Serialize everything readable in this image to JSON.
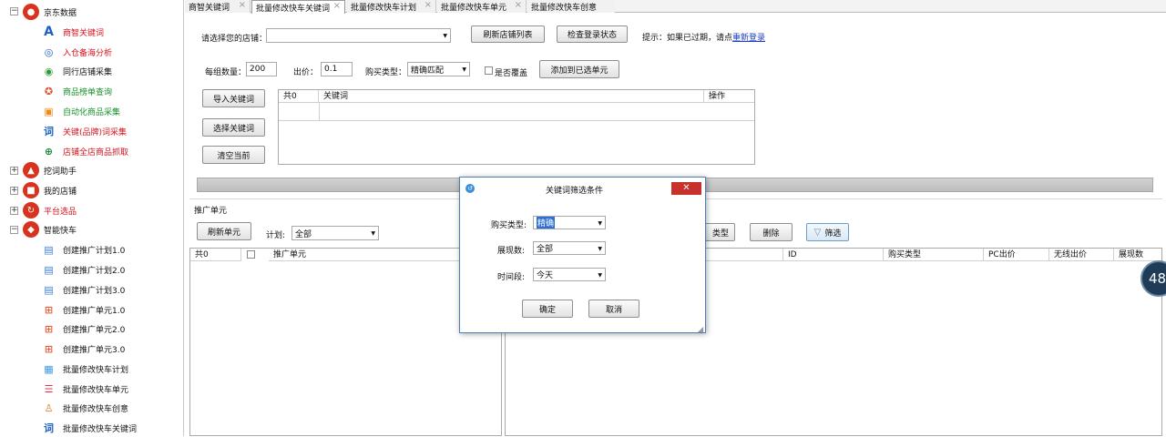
{
  "sidebar": {
    "root_label": "京东数据",
    "children": [
      {
        "label": "商智关键词",
        "color": "#d8101b",
        "icon": "font-a-icon"
      },
      {
        "label": "入仓备海分析",
        "color": "#d8101b",
        "icon": "target-icon"
      },
      {
        "label": "同行店铺采集",
        "color": "#111111",
        "icon": "eye-icon"
      },
      {
        "label": "商品榜单查询",
        "color": "#16932a",
        "icon": "medal-icon"
      },
      {
        "label": "自动化商品采集",
        "color": "#16932a",
        "icon": "bag-icon"
      },
      {
        "label": "关键(品牌)词采集",
        "color": "#d8101b",
        "icon": "keyword-search-icon"
      },
      {
        "label": "店铺全店商品抓取",
        "color": "#d8101b",
        "icon": "globe-search-icon"
      }
    ],
    "groups": [
      {
        "label": "挖词助手",
        "color": "#111111"
      },
      {
        "label": "我的店铺",
        "color": "#111111"
      },
      {
        "label": "平台选品",
        "color": "#d8101b"
      }
    ],
    "car_label": "智能快车",
    "car_children": [
      "创建推广计划1.0",
      "创建推广计划2.0",
      "创建推广计划3.0",
      "创建推广单元1.0",
      "创建推广单元2.0",
      "创建推广单元3.0",
      "批量修改快车计划",
      "批量修改快车单元",
      "批量修改快车创意",
      "批量修改快车关键词"
    ],
    "expander_minus": "⊟",
    "expander_plus": "⊞"
  },
  "tabs": [
    {
      "label": "商智关键词",
      "active": false
    },
    {
      "label": "批量修改快车关键词",
      "active": true
    },
    {
      "label": "批量修改快车计划",
      "active": false
    },
    {
      "label": "批量修改快车单元",
      "active": false
    },
    {
      "label": "批量修改快车创意",
      "active": false
    }
  ],
  "tab_close": "×",
  "form": {
    "shop_label": "请选择您的店铺：",
    "shop_value": "",
    "refresh_shop_btn": "刷新店铺列表",
    "check_login_btn": "检查登录状态",
    "hint": "提示：如果已过期，请点",
    "relogin_link": "重新登录",
    "group_count_label": "每组数量：",
    "group_count_value": "200",
    "bid_label": "出价：",
    "bid_value": "0.1",
    "buy_type_label": "购买类型：",
    "buy_type_value": "精确匹配",
    "overwrite_label": "是否覆盖",
    "add_to_unit_btn": "添加到已选单元",
    "import_kw_btn": "导入关键词",
    "select_kw_btn": "选择关键词",
    "clear_btn": "清空当前"
  },
  "kw_grid": {
    "headers": [
      "共0",
      "关键词",
      "操作"
    ]
  },
  "unit_section": {
    "title": "推广单元",
    "refresh_unit_btn": "刷新单元",
    "plan_label": "计划:",
    "plan_value": "全部",
    "headers": [
      "共0",
      "推广单元"
    ]
  },
  "right_panel": {
    "type_btn_partial": "类型",
    "delete_btn": "删除",
    "filter_btn": "筛选",
    "headers": [
      "ID",
      "购买类型",
      "PC出价",
      "无线出价",
      "展现数"
    ]
  },
  "dialog": {
    "title": "关键词筛选条件",
    "close_glyph": "✕",
    "buy_type_label": "购买类型:",
    "buy_type_value": "精确",
    "impressions_label": "展现数:",
    "impressions_value": "全部",
    "period_label": "时间段:",
    "period_value": "今天",
    "ok_btn": "确定",
    "cancel_btn": "取消"
  },
  "floating_badge": "48",
  "colors": {
    "accent_red": "#d8331f",
    "dialog_border": "#4d7fb7",
    "close_red": "#c8302b",
    "link_blue": "#1a3fc5"
  }
}
